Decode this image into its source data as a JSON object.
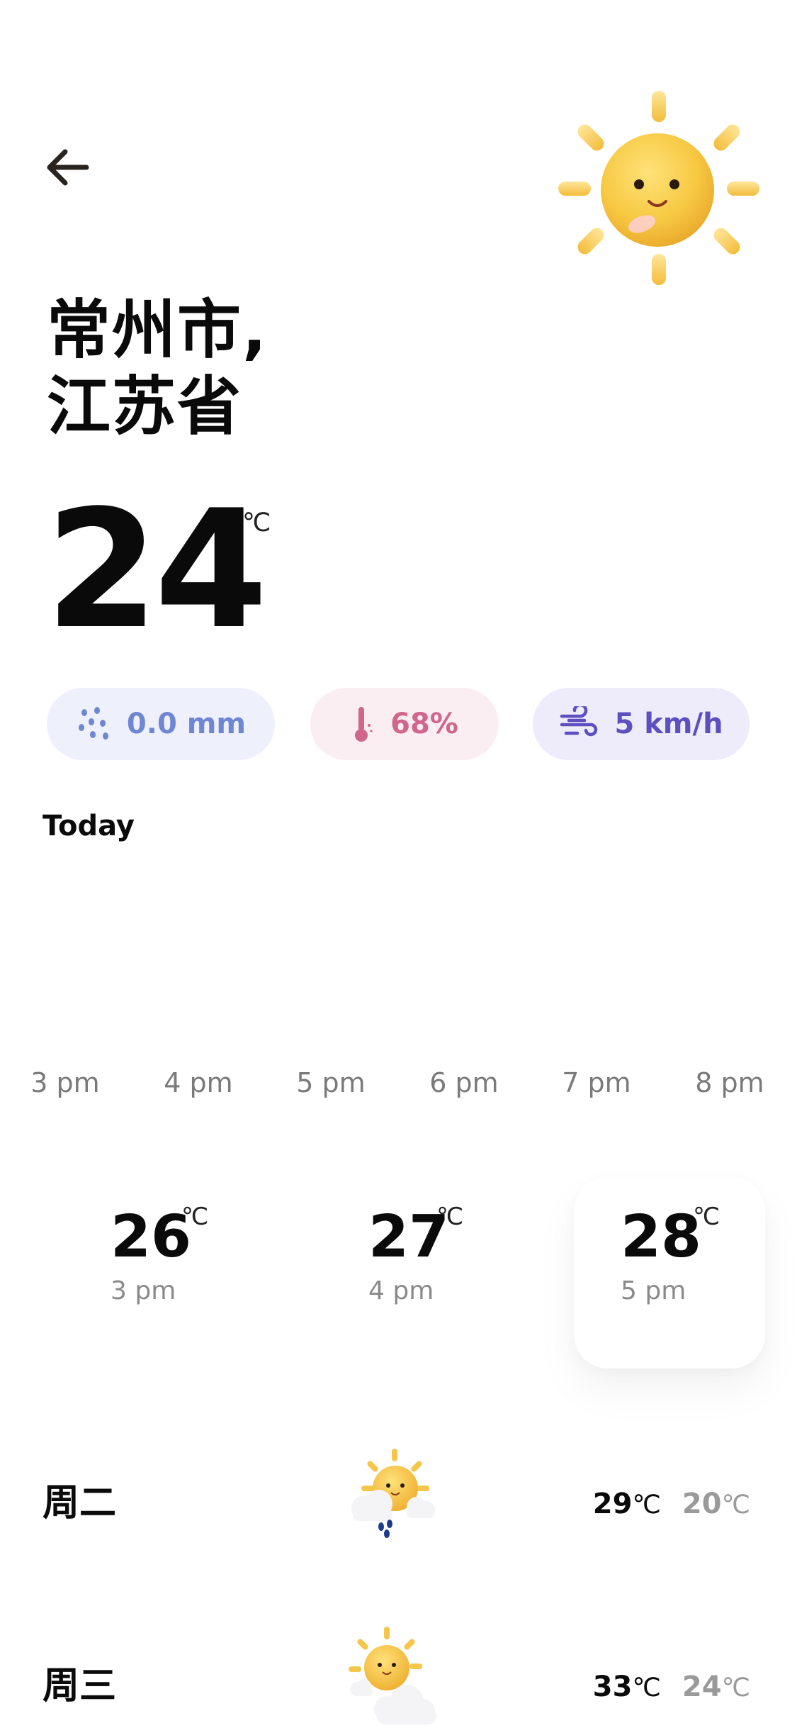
{
  "header": {
    "back_icon": "arrow-left-icon",
    "hero_icon": "sun-smiling-icon"
  },
  "location": {
    "line1": "常州市,",
    "line2": "江苏省"
  },
  "current": {
    "temperature": "24",
    "unit": "℃"
  },
  "stats": {
    "rain": {
      "icon": "rain-drops-icon",
      "value": "0.0 mm",
      "color": "#6f86d3",
      "bg": "#eef1fb"
    },
    "humidity": {
      "icon": "thermometer-icon",
      "value": "68%",
      "color": "#d0668c",
      "bg": "#fbeef2"
    },
    "wind": {
      "icon": "wind-icon",
      "value": "5 km/h",
      "color": "#5e4fc0",
      "bg": "#eeebfa"
    }
  },
  "today": {
    "title": "Today",
    "hour_axis": [
      "3 pm",
      "4 pm",
      "5 pm",
      "6 pm",
      "7 pm",
      "8 pm"
    ],
    "hourly": [
      {
        "temp": "26",
        "unit": "℃",
        "time": "3 pm",
        "selected": false
      },
      {
        "temp": "27",
        "unit": "℃",
        "time": "4 pm",
        "selected": false
      },
      {
        "temp": "28",
        "unit": "℃",
        "time": "5 pm",
        "selected": true
      }
    ]
  },
  "daily": [
    {
      "day": "周二",
      "icon": "sun-cloud-rain-icon",
      "high": "29",
      "low": "20",
      "unit": "℃"
    },
    {
      "day": "周三",
      "icon": "sun-cloud-icon",
      "high": "33",
      "low": "24",
      "unit": "℃"
    }
  ]
}
